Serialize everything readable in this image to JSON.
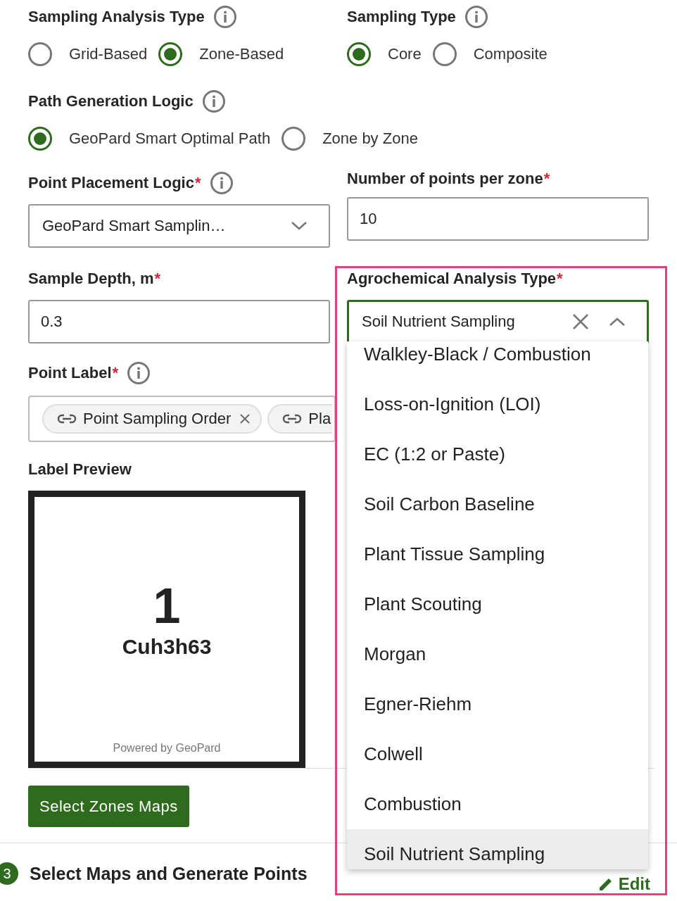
{
  "sampling_analysis_type": {
    "label": "Sampling Analysis Type",
    "options": [
      {
        "label": "Grid-Based",
        "selected": false
      },
      {
        "label": "Zone-Based",
        "selected": true
      }
    ]
  },
  "sampling_type": {
    "label": "Sampling Type",
    "options": [
      {
        "label": "Core",
        "selected": true
      },
      {
        "label": "Composite",
        "selected": false
      }
    ]
  },
  "path_generation_logic": {
    "label": "Path Generation Logic",
    "options": [
      {
        "label": "GeoPard Smart Optimal Path",
        "selected": true
      },
      {
        "label": "Zone by Zone",
        "selected": false
      }
    ]
  },
  "point_placement_logic": {
    "label": "Point Placement Logic",
    "required_mark": "*",
    "value": "GeoPard Smart Samplin…"
  },
  "points_per_zone": {
    "label": "Number of points per zone",
    "required_mark": "*",
    "value": "10"
  },
  "sample_depth": {
    "label": "Sample Depth, m",
    "required_mark": "*",
    "value": "0.3"
  },
  "agrochemical_analysis_type": {
    "label": "Agrochemical Analysis Type",
    "required_mark": "*",
    "value": "Soil Nutrient Sampling",
    "options": [
      {
        "label": "Walkley-Black / Combustion",
        "selected": false
      },
      {
        "label": "Loss-on-Ignition (LOI)",
        "selected": false
      },
      {
        "label": "EC (1:2 or Paste)",
        "selected": false
      },
      {
        "label": "Soil Carbon Baseline",
        "selected": false
      },
      {
        "label": "Plant Tissue Sampling",
        "selected": false
      },
      {
        "label": "Plant Scouting",
        "selected": false
      },
      {
        "label": "Morgan",
        "selected": false
      },
      {
        "label": "Egner-Riehm",
        "selected": false
      },
      {
        "label": "Colwell",
        "selected": false
      },
      {
        "label": "Combustion",
        "selected": false
      },
      {
        "label": "Soil Nutrient Sampling",
        "selected": true
      }
    ]
  },
  "point_label": {
    "label": "Point Label",
    "required_mark": "*",
    "chips": [
      "Point Sampling Order",
      "Pla"
    ]
  },
  "label_preview": {
    "label": "Label Preview",
    "number": "1",
    "code": "Cuh3h63",
    "footer": "Powered by GeoPard"
  },
  "select_zones_button": "Select Zones Maps",
  "step": {
    "number": "3",
    "title": "Select Maps and Generate Points",
    "action": "Edit"
  }
}
